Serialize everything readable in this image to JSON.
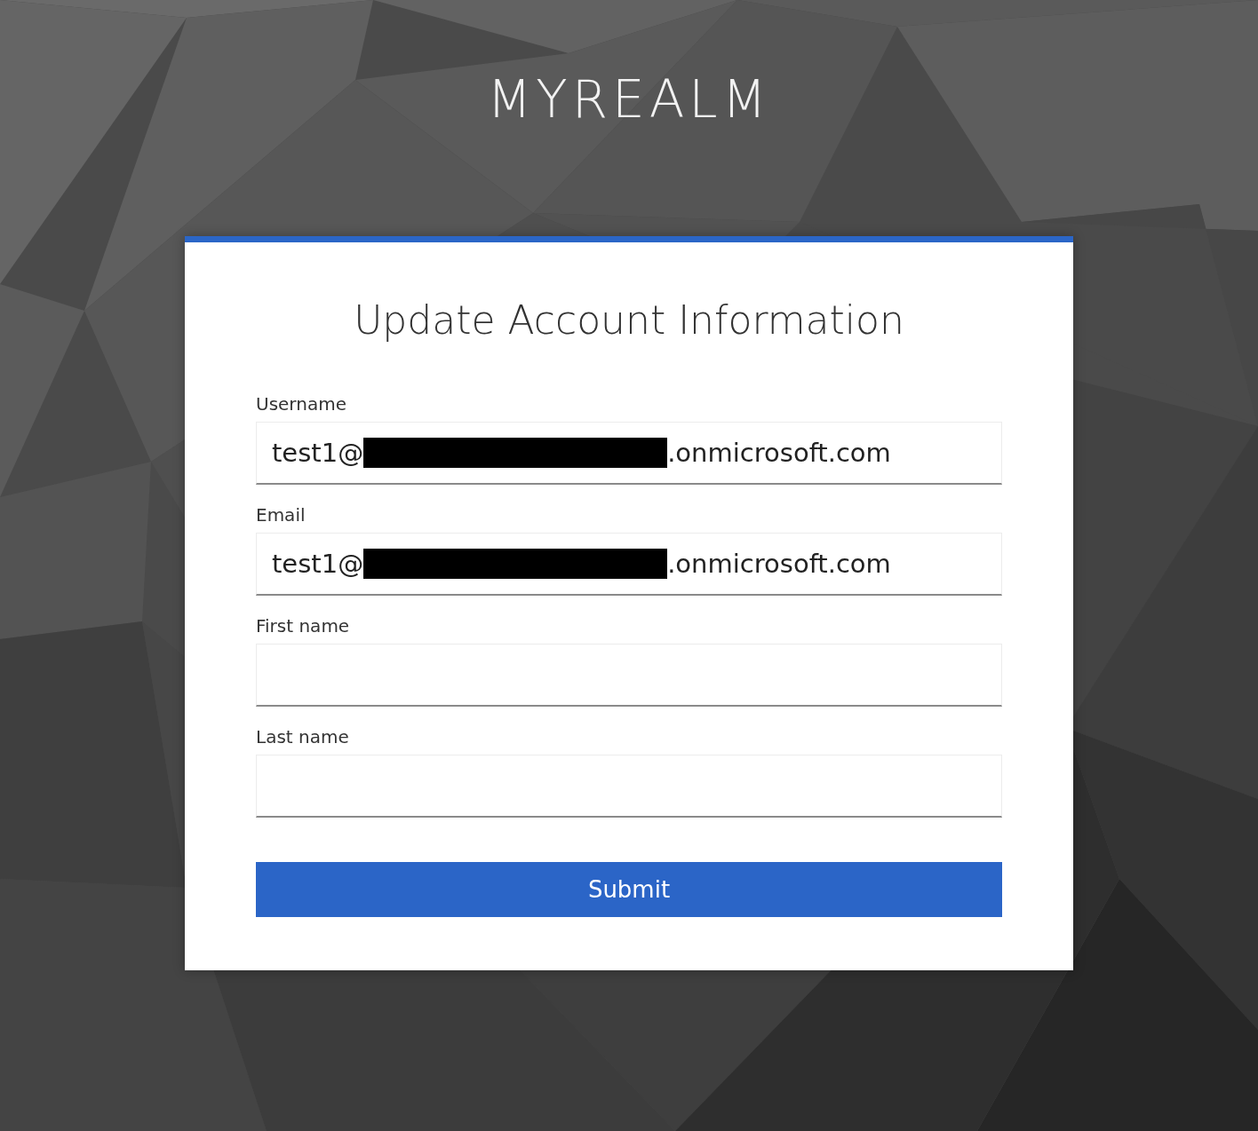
{
  "realm": {
    "name": "MYREALM"
  },
  "form": {
    "title": "Update Account Information",
    "fields": [
      {
        "label": "Username",
        "value_start": "test1@",
        "redacted": true,
        "value_end": ".onmicrosoft.com"
      },
      {
        "label": "Email",
        "value_start": "test1@",
        "redacted": true,
        "value_end": ".onmicrosoft.com"
      },
      {
        "label": "First name"
      },
      {
        "label": "Last name"
      }
    ],
    "submit": "Submit"
  }
}
